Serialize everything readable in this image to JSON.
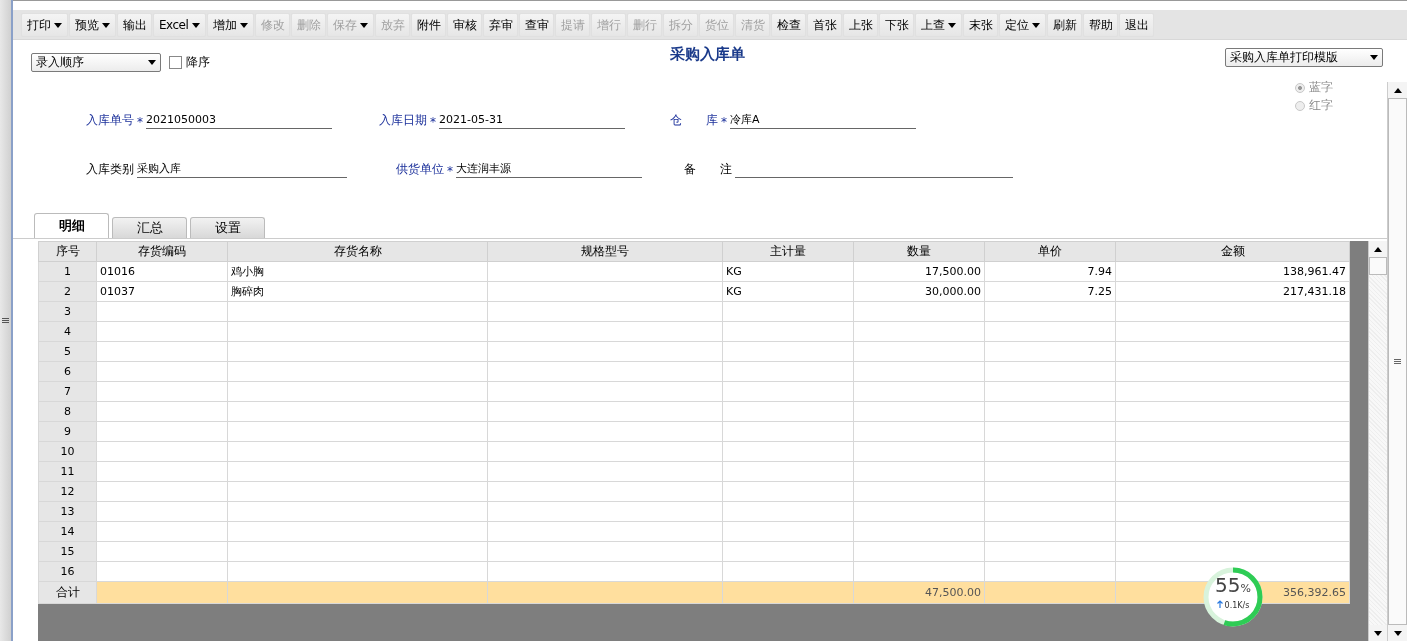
{
  "toolbar": [
    {
      "label": "打印",
      "dropdown": true,
      "disabled": false
    },
    {
      "label": "预览",
      "dropdown": true,
      "disabled": false
    },
    {
      "label": "输出",
      "dropdown": false,
      "disabled": false
    },
    {
      "label": "Excel",
      "dropdown": true,
      "disabled": false
    },
    {
      "label": "增加",
      "dropdown": true,
      "disabled": false
    },
    {
      "label": "修改",
      "dropdown": false,
      "disabled": true
    },
    {
      "label": "删除",
      "dropdown": false,
      "disabled": true
    },
    {
      "label": "保存",
      "dropdown": true,
      "disabled": true
    },
    {
      "label": "放弃",
      "dropdown": false,
      "disabled": true
    },
    {
      "label": "附件",
      "dropdown": false,
      "disabled": false
    },
    {
      "label": "审核",
      "dropdown": false,
      "disabled": false
    },
    {
      "label": "弃审",
      "dropdown": false,
      "disabled": false
    },
    {
      "label": "查审",
      "dropdown": false,
      "disabled": false
    },
    {
      "label": "提请",
      "dropdown": false,
      "disabled": true
    },
    {
      "label": "增行",
      "dropdown": false,
      "disabled": true
    },
    {
      "label": "删行",
      "dropdown": false,
      "disabled": true
    },
    {
      "label": "拆分",
      "dropdown": false,
      "disabled": true
    },
    {
      "label": "货位",
      "dropdown": false,
      "disabled": true
    },
    {
      "label": "清货",
      "dropdown": false,
      "disabled": true
    },
    {
      "label": "检查",
      "dropdown": false,
      "disabled": false
    },
    {
      "label": "首张",
      "dropdown": false,
      "disabled": false
    },
    {
      "label": "上张",
      "dropdown": false,
      "disabled": false
    },
    {
      "label": "下张",
      "dropdown": false,
      "disabled": false
    },
    {
      "label": "上查",
      "dropdown": true,
      "disabled": false
    },
    {
      "label": "末张",
      "dropdown": false,
      "disabled": false
    },
    {
      "label": "定位",
      "dropdown": true,
      "disabled": false
    },
    {
      "label": "刷新",
      "dropdown": false,
      "disabled": false
    },
    {
      "label": "帮助",
      "dropdown": false,
      "disabled": false
    },
    {
      "label": "退出",
      "dropdown": false,
      "disabled": false
    }
  ],
  "sort": {
    "value": "录入顺序",
    "descending_label": "降序",
    "descending": false
  },
  "title": "采购入库单",
  "template": {
    "value": "采购入库单打印模版"
  },
  "radios": [
    {
      "label": "蓝字",
      "selected": true,
      "disabled": true
    },
    {
      "label": "红字",
      "selected": false,
      "disabled": true
    }
  ],
  "fields": [
    [
      {
        "label": "入库单号",
        "required": true,
        "marker": "*",
        "value": "2021050003"
      },
      {
        "label": "入库日期",
        "required": true,
        "marker": "*",
        "value": "2021-05-31"
      },
      {
        "label": "仓　　库",
        "required": true,
        "marker": "*",
        "value": "冷库A"
      }
    ],
    [
      {
        "label": "入库类别",
        "required": false,
        "value": "采购入库"
      },
      {
        "label": "供货单位",
        "required": true,
        "marker": "*",
        "value": "大连润丰源"
      },
      {
        "label": "备　　注",
        "required": false
      }
    ]
  ],
  "tabs": [
    {
      "label": "明细",
      "selected": true
    },
    {
      "label": "汇总",
      "selected": false
    },
    {
      "label": "设置",
      "selected": false
    }
  ],
  "table": {
    "index_header": "序号",
    "columns": [
      {
        "label": "存货编码",
        "kind": "text"
      },
      {
        "label": "存货名称",
        "kind": "text"
      },
      {
        "label": "规格型号",
        "kind": "text"
      },
      {
        "label": "主计量",
        "kind": "text"
      },
      {
        "label": "数量",
        "kind": "number"
      },
      {
        "label": "单价",
        "kind": "number"
      },
      {
        "label": "金额",
        "kind": "number"
      }
    ],
    "rows": [
      {
        "no": "1",
        "code": "01016",
        "name": "鸡小胸",
        "unit": "KG",
        "qty": "17,500.00",
        "price": "7.94",
        "amount": "138,961.47"
      },
      {
        "no": "2",
        "code": "01037",
        "name": "胸碎肉",
        "unit": "KG",
        "qty": "30,000.00",
        "price": "7.25",
        "amount": "217,431.18"
      },
      {
        "no": "3"
      },
      {
        "no": "4"
      },
      {
        "no": "5"
      },
      {
        "no": "6"
      },
      {
        "no": "7"
      },
      {
        "no": "8"
      },
      {
        "no": "9"
      },
      {
        "no": "10"
      },
      {
        "no": "11"
      },
      {
        "no": "12"
      },
      {
        "no": "13"
      },
      {
        "no": "14"
      },
      {
        "no": "15"
      },
      {
        "no": "16"
      }
    ],
    "totals": {
      "no": "合计",
      "qty": "47,500.00",
      "amount": "356,392.65"
    }
  },
  "net_meter": {
    "percent": "55",
    "unit": "%",
    "speed": "0.1K/s",
    "level": 0.55
  }
}
